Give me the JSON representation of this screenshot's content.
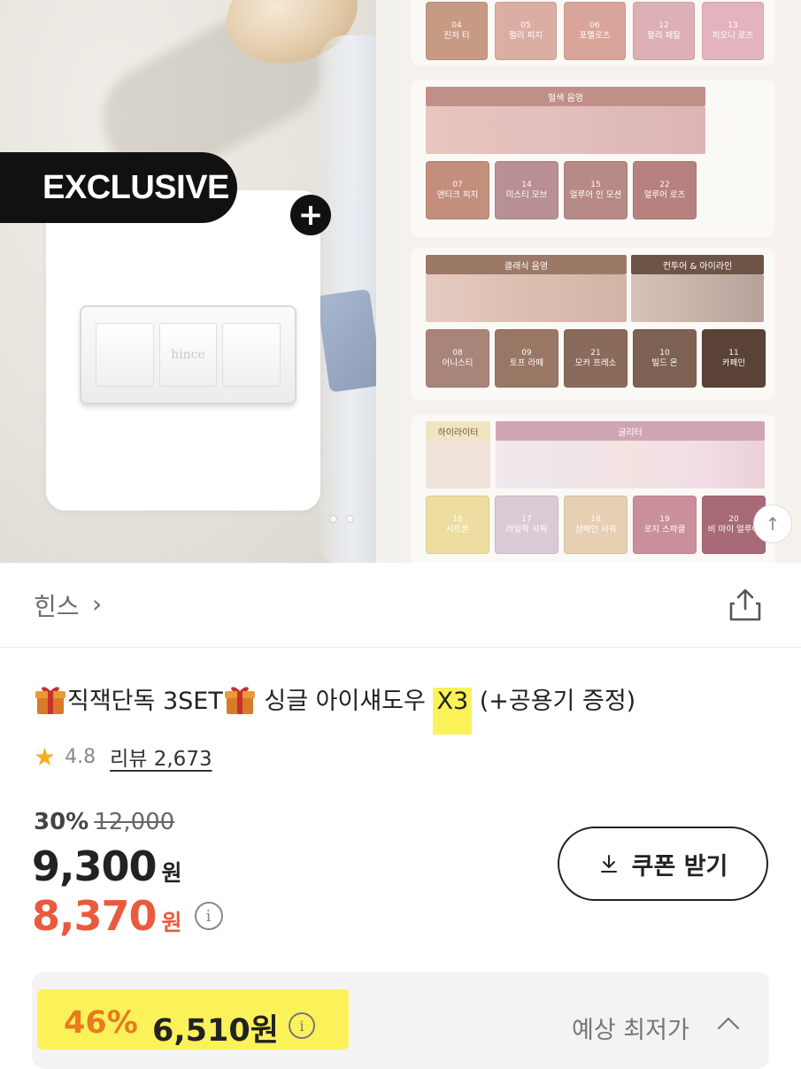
{
  "hero": {
    "badge": "EXCLUSIVE",
    "plus": "+",
    "case_logo": "hince",
    "swatches_top": [
      {
        "num": "04",
        "name": "진저 티",
        "color": "#c79a84"
      },
      {
        "num": "05",
        "name": "펄리 피치",
        "color": "#dbaea4"
      },
      {
        "num": "06",
        "name": "포멜로즈",
        "color": "#d9a59a"
      },
      {
        "num": "12",
        "name": "펄리 페탈",
        "color": "#dcb0b5"
      },
      {
        "num": "13",
        "name": "피오니 로즈",
        "color": "#e3b4bd"
      }
    ],
    "group_a": {
      "label": "혈색 음영",
      "swatches": [
        {
          "num": "07",
          "name": "앤티크 피치",
          "color": "#c38e7c"
        },
        {
          "num": "14",
          "name": "미스티 모브",
          "color": "#b88f95"
        },
        {
          "num": "15",
          "name": "얼루어 인 모션",
          "color": "#b78a87"
        },
        {
          "num": "22",
          "name": "얼루어 로즈",
          "color": "#b6817f"
        }
      ]
    },
    "group_b": {
      "label": "클래식 음영",
      "label2": "컨투어 & 아이라인",
      "swatches": [
        {
          "num": "08",
          "name": "어니스티",
          "color": "#a98479"
        },
        {
          "num": "09",
          "name": "토프 라떼",
          "color": "#9a7765"
        },
        {
          "num": "21",
          "name": "모카 프레소",
          "color": "#8a6a5a"
        },
        {
          "num": "10",
          "name": "빌드 온",
          "color": "#7d6253"
        },
        {
          "num": "11",
          "name": "카페인",
          "color": "#5a4237"
        }
      ]
    },
    "group_c": {
      "label": "하이라이터",
      "label2": "글리터",
      "swatches": [
        {
          "num": "16",
          "name": "시트론",
          "color": "#eedda0"
        },
        {
          "num": "17",
          "name": "라일락 샤워",
          "color": "#d9cad6"
        },
        {
          "num": "18",
          "name": "샴페인 샤워",
          "color": "#e6cfb2"
        },
        {
          "num": "19",
          "name": "로지 스파클",
          "color": "#c98f9a"
        },
        {
          "num": "20",
          "name": "비 마이 얼루어",
          "color": "#a86a76"
        }
      ]
    }
  },
  "brand": {
    "name": "힌스",
    "chevron": "›"
  },
  "product": {
    "title_part1": "직잭단독 3SET",
    "title_part2": " 싱글 아이섀도우 ",
    "title_highlight": "X3",
    "title_part3": " (+공용기 증정)",
    "rating": "4.8",
    "review_label": "리뷰 2,673",
    "discount_pct": "30%",
    "original_price": "12,000",
    "price": "9,300",
    "price_unit": "원",
    "coupon_price": "8,370",
    "coupon_unit": "원",
    "info_glyph": "i"
  },
  "coupon_button": {
    "label": "쿠폰 받기"
  },
  "best_price": {
    "pct": "46%",
    "price": "6,510원",
    "label": "예상 최저가",
    "chevron": "^"
  },
  "colors": {
    "sale": "#ea5a3d",
    "best_pct": "#ea7a1d",
    "highlight": "#fbf25a",
    "star": "#f2b01e"
  }
}
